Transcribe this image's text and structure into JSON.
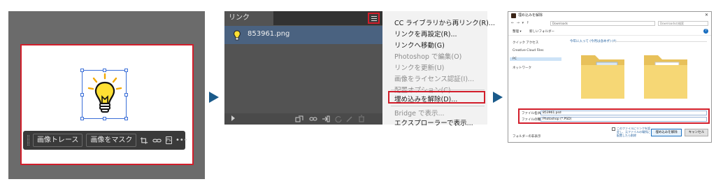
{
  "colors": {
    "highlight_red": "#d21e2b",
    "arrow_blue": "#1a5a8a",
    "selection_blue": "#3b6fd8"
  },
  "step1": {
    "context_bar": {
      "image_trace_label": "画像トレース",
      "mask_image_label": "画像をマスク",
      "icons": [
        "crop-image-icon",
        "link-icon",
        "ps-edit-icon",
        "more-icon"
      ],
      "ps_text": "Ps",
      "more_text": "•••"
    }
  },
  "step2": {
    "panel": {
      "tab_label": "リンク",
      "file_name": "853961.png"
    },
    "menu": {
      "items": [
        {
          "label": "CC ライブラリから再リンク(R)...",
          "disabled": false
        },
        {
          "label": "リンクを再設定(R)...",
          "disabled": false
        },
        {
          "label": "リンクへ移動(G)",
          "disabled": false
        },
        {
          "label": "Photoshop で編集(O)",
          "disabled": true
        },
        {
          "label": "リンクを更新(U)",
          "disabled": true
        },
        {
          "label": "画像をライセンス認証(I)...",
          "disabled": true
        },
        {
          "label": "配置オプション(C)...",
          "disabled": true
        },
        {
          "label": "埋め込みを解除(D)...",
          "disabled": false
        },
        {
          "label": "Bridge で表示...",
          "disabled": true
        },
        {
          "label": "エクスプローラーで表示...",
          "disabled": false
        }
      ]
    }
  },
  "step3": {
    "dialog": {
      "title": "埋め込みを解除",
      "address": "Downloads",
      "search_placeholder": "Downloadsの検索",
      "cmd_organize": "整理 ▾",
      "cmd_new_folder": "新しいフォルダー",
      "nav_items": [
        "クイック アクセス",
        "Creative Cloud Files",
        "PC",
        "ネットワーク"
      ],
      "group_label": "今年に入って (今月は含めず) (4)",
      "file_name_label": "ファイル名(N):",
      "file_name_value": "853961.psd",
      "file_type_label": "ファイルの種類(T):",
      "file_type_value": "Photoshop (*.PSD)",
      "hide_folders": "フォルダーの非表示",
      "checkbox_label": "このファイルにリンクを設定し、元ファイルの場所に配置したら削除",
      "save_button": "埋め込みを解除",
      "cancel_button": "キャンセル",
      "help": "?"
    }
  }
}
